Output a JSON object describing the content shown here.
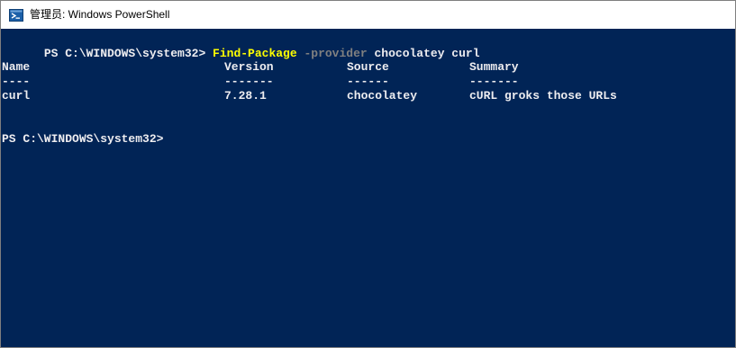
{
  "window": {
    "title": "管理员: Windows PowerShell"
  },
  "colors": {
    "console_background": "#012456",
    "console_text": "#eeedf0",
    "command_color": "#ffff00",
    "parameter_color": "#808080"
  },
  "console": {
    "command_line": {
      "prompt": "PS C:\\WINDOWS\\system32> ",
      "command": "Find-Package",
      "parameter": " -provider",
      "arguments": " chocolatey curl"
    },
    "table": {
      "headers": [
        "Name",
        "Version",
        "Source",
        "Summary"
      ],
      "underlines": [
        "----",
        "-------",
        "------",
        "-------"
      ],
      "rows": [
        [
          "curl",
          "7.28.1",
          "chocolatey",
          "cURL groks those URLs"
        ]
      ]
    },
    "prompt_line": "PS C:\\WINDOWS\\system32>"
  }
}
